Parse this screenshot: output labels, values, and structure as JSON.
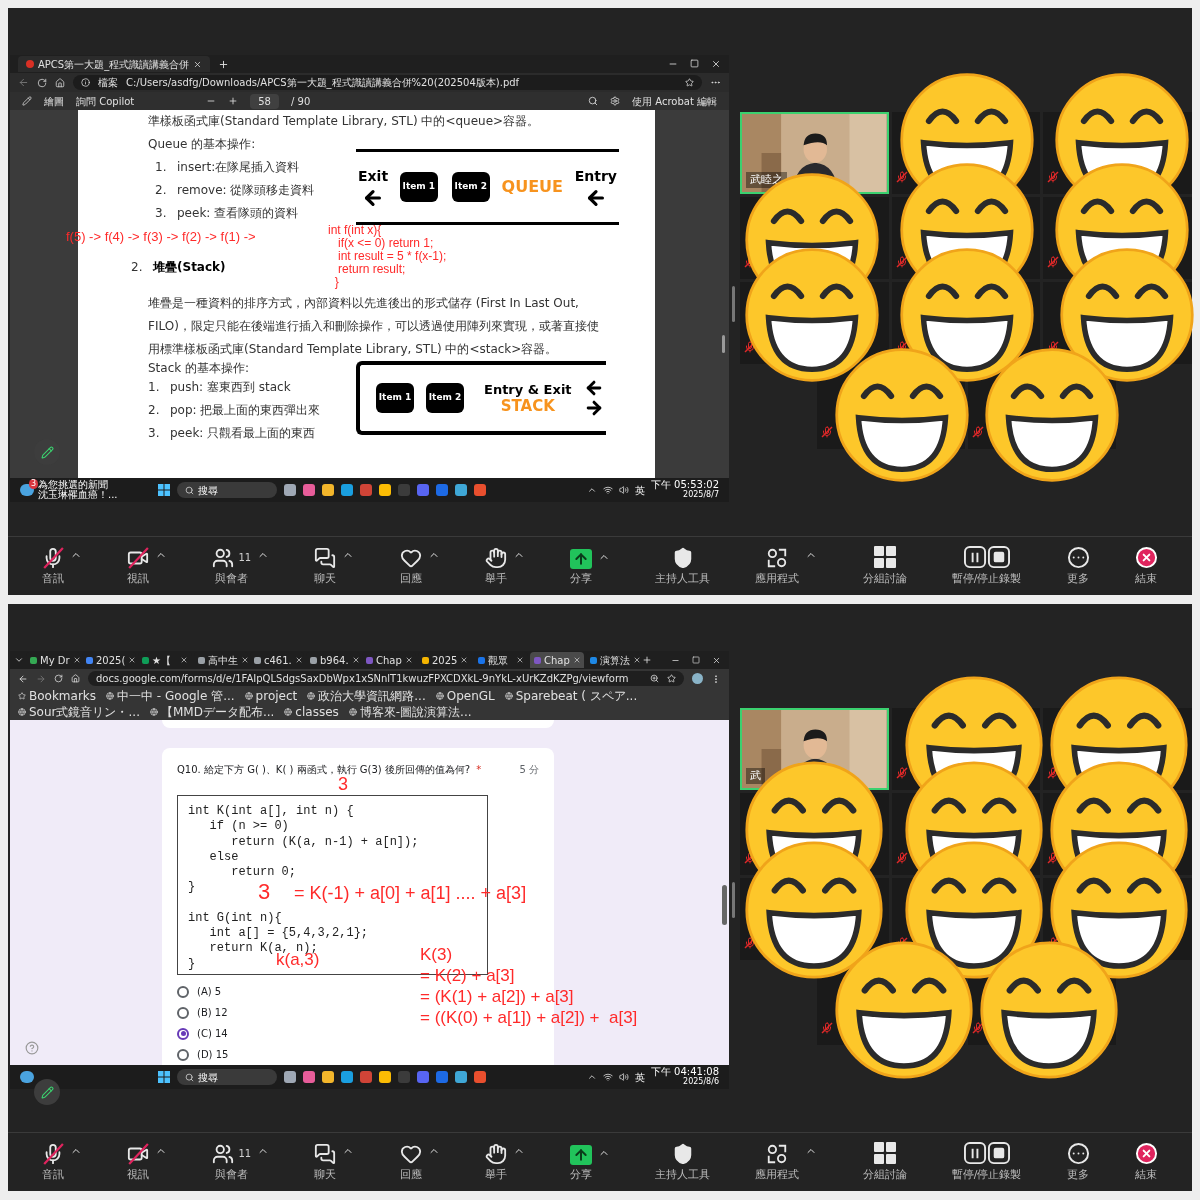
{
  "meetings": [
    {
      "shared_screen": {
        "kind": "pdf",
        "browser": {
          "tabs": [
            {
              "label": "APCS第一大題_程式識讀講義合併",
              "selected": true
            }
          ],
          "address_badge": "檔案",
          "url": "C:/Users/asdfg/Downloads/APCS第一大題_程式識讀講義合併%20(202504版本).pdf",
          "pdf_toolbar": {
            "draw": "繪圖",
            "copilot": "詢問 Copilot",
            "page": "58",
            "pages": "/ 90",
            "edit": "使用 Acrobat 編輯"
          }
        },
        "document": {
          "intro": "準樣板函式庫(Standard Template Library, STL) 中的<queue>容器。",
          "queue_heading": "Queue 的基本操作:",
          "queue_ops": [
            {
              "number": "1.",
              "text": "insert:在隊尾插入資料"
            },
            {
              "number": "2.",
              "text": "remove: 從隊頭移走資料"
            },
            {
              "number": "3.",
              "text": "peek: 查看隊頭的資料"
            }
          ],
          "queue_diagram": {
            "exit": "Exit",
            "items": [
              "Item 1",
              "Item 2"
            ],
            "title": "QUEUE",
            "entry": "Entry"
          },
          "section_number": "2.",
          "section_title": "堆疊(Stack)",
          "paragraph": "堆疊是一種資料的排序方式，內部資料以先進後出的形式儲存 (First In Last Out, FILO)，限定只能在後端進行插入和刪除操作，可以透過使用陣列來實現，或著直接使用標準樣板函式庫(Standard Template Library, STL) 中的<stack>容器。",
          "stack_heading": "Stack 的基本操作:",
          "stack_ops": [
            {
              "number": "1.",
              "text": "push: 塞東西到 stack"
            },
            {
              "number": "2.",
              "text": "pop: 把最上面的東西彈出來"
            },
            {
              "number": "3.",
              "text": "peek: 只觀看最上面的東西"
            }
          ],
          "stack_diagram": {
            "items": [
              "Item 1",
              "Item 2"
            ],
            "label": "Entry & Exit",
            "title": "STACK"
          }
        },
        "annotations": [
          {
            "kind": "chain",
            "lines": [
              "f(5) -> f(4) -> f(3) -> f(2) -> f(1) ->"
            ]
          },
          {
            "kind": "code",
            "lines": [
              "int f(int x){",
              "   if(x <= 0) return 1;",
              "   int result = 5 * f(x-1);",
              "   return result;",
              "  }"
            ]
          }
        ],
        "taskbar": {
          "news": {
            "badge": "3",
            "title": "為您挑選的新聞",
            "headline": "沈玉琳罹血癌！..."
          },
          "search": "搜尋",
          "ime": "英",
          "time": "下午 05:53:02",
          "date": "2025/8/7"
        }
      },
      "gallery": {
        "self_view_name": "武睦之"
      },
      "toolbar": [
        {
          "kind": "audio",
          "label": "音訊",
          "caret": true,
          "slashed": true
        },
        {
          "kind": "video",
          "label": "視訊",
          "caret": true,
          "slashed": true
        },
        {
          "kind": "participants",
          "label": "與會者",
          "count": "11",
          "caret": true,
          "slashed": false
        },
        {
          "kind": "chat",
          "label": "聊天",
          "caret": true,
          "slashed": false
        },
        {
          "kind": "reactions",
          "label": "回應",
          "caret": true,
          "slashed": false
        },
        {
          "kind": "raise_hand",
          "label": "舉手",
          "caret": true,
          "slashed": false
        },
        {
          "kind": "share",
          "label": "分享",
          "caret": true,
          "slashed": false
        },
        {
          "kind": "host_tools",
          "label": "主持人工具",
          "caret": false,
          "slashed": false
        },
        {
          "kind": "apps",
          "label": "應用程式",
          "caret": true,
          "slashed": false
        },
        {
          "kind": "breakout",
          "label": "分組討論",
          "caret": false,
          "slashed": false
        },
        {
          "kind": "record",
          "label": "暫停/停止錄製",
          "caret": false,
          "slashed": false
        },
        {
          "kind": "more",
          "label": "更多",
          "caret": false,
          "slashed": false
        },
        {
          "kind": "end",
          "label": "結束",
          "caret": false,
          "slashed": false
        }
      ]
    },
    {
      "shared_screen": {
        "kind": "form",
        "browser": {
          "tabs": [
            {
              "label": "My Dr",
              "selected": false,
              "color": "#34a853"
            },
            {
              "label": "2025(",
              "selected": false,
              "color": "#4285f4"
            },
            {
              "label": "★【",
              "selected": false,
              "color": "#0f9d58"
            },
            {
              "label": "高中生",
              "selected": false,
              "color": "#9aa0a6"
            },
            {
              "label": "c461.",
              "selected": false,
              "color": "#9aa0a6"
            },
            {
              "label": "b964.",
              "selected": false,
              "color": "#9aa0a6"
            },
            {
              "label": "Chap",
              "selected": false,
              "color": "#7e57c2"
            },
            {
              "label": "2025",
              "selected": false,
              "color": "#f4b400"
            },
            {
              "label": "觀眾",
              "selected": false,
              "color": "#1a73e8"
            },
            {
              "label": "Chap",
              "selected": true,
              "color": "#7e57c2"
            },
            {
              "label": "演算法",
              "selected": false,
              "color": "#1e88e5"
            }
          ],
          "url": "docs.google.com/forms/d/e/1FAIpQLSdgsSaxDbWpx1xSNnlT1kwuzFPXCDXkL-9nYkL-xUrKZdKZPg/viewform",
          "bookmarks": [
            "Bookmarks",
            "中一中 - Google 管...",
            "project",
            "政治大學資訊網路...",
            "OpenGL",
            "Sparebeat ( スペア...",
            "Sour式鏡音リン・...",
            "【MMDデータ配布...",
            "classes",
            "博客來-圖說演算法..."
          ]
        },
        "form": {
          "question": "Q10. 給定下方 G( )、K( ) 兩函式，執行 G(3) 後所回傳的值為何?",
          "required": "*",
          "points": "5 分",
          "code": [
            [
              "int K(int a[], int n) {",
              "   if (n >= 0)",
              "      return (K(a, n-1) + a[n]);",
              "   else",
              "      return 0;",
              "}"
            ],
            [
              "int G(int n){",
              "   int a[] = {5,4,3,2,1};",
              "   return K(a, n);",
              "}"
            ]
          ],
          "options": [
            {
              "label": "(A) 5",
              "selected": false
            },
            {
              "label": "(B) 12",
              "selected": false
            },
            {
              "label": "(C) 14",
              "selected": true
            },
            {
              "label": "(D) 15",
              "selected": false
            }
          ]
        },
        "annotations": [
          {
            "kind": "above",
            "lines": [
              "3"
            ]
          },
          {
            "kind": "left",
            "lines": [
              "3"
            ]
          },
          {
            "kind": "sum",
            "lines": [
              "= K(-1) + a[0] + a[1] .... + a[3]"
            ]
          },
          {
            "kind": "call",
            "lines": [
              "k(a,3)"
            ]
          },
          {
            "kind": "expansion",
            "lines": [
              "K(3)",
              "= K(2) + a[3]",
              "= (K(1) + a[2]) + a[3]",
              "= ((K(0) + a[1]) + a[2]) +  a[3]"
            ]
          }
        ],
        "taskbar": {
          "search": "搜尋",
          "ime": "英",
          "time": "下午 04:41:08",
          "date": "2025/8/6"
        }
      },
      "gallery": {
        "self_view_name": "武"
      },
      "toolbar": [
        {
          "kind": "audio",
          "label": "音訊",
          "caret": true,
          "slashed": true
        },
        {
          "kind": "video",
          "label": "視訊",
          "caret": true,
          "slashed": true
        },
        {
          "kind": "participants",
          "label": "與會者",
          "count": "11",
          "caret": true,
          "slashed": false
        },
        {
          "kind": "chat",
          "label": "聊天",
          "caret": true,
          "slashed": false
        },
        {
          "kind": "reactions",
          "label": "回應",
          "caret": true,
          "slashed": false
        },
        {
          "kind": "raise_hand",
          "label": "舉手",
          "caret": true,
          "slashed": false
        },
        {
          "kind": "share",
          "label": "分享",
          "caret": true,
          "slashed": false
        },
        {
          "kind": "host_tools",
          "label": "主持人工具",
          "caret": false,
          "slashed": false
        },
        {
          "kind": "apps",
          "label": "應用程式",
          "caret": true,
          "slashed": false
        },
        {
          "kind": "breakout",
          "label": "分組討論",
          "caret": false,
          "slashed": false
        },
        {
          "kind": "record",
          "label": "暫停/停止錄製",
          "caret": false,
          "slashed": false
        },
        {
          "kind": "more",
          "label": "更多",
          "caret": false,
          "slashed": false
        },
        {
          "kind": "end",
          "label": "結束",
          "caret": false,
          "slashed": false
        }
      ]
    }
  ]
}
